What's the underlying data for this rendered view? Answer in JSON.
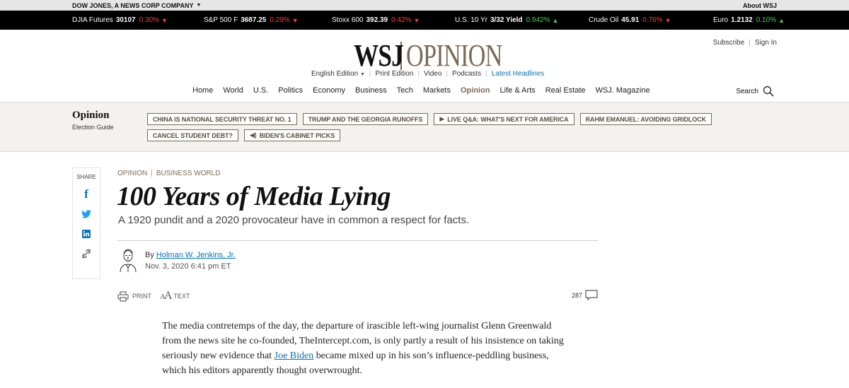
{
  "topstrip": {
    "brand": "DOW JONES, A NEWS CORP COMPANY",
    "about": "About WSJ"
  },
  "ticker": [
    {
      "name": "DJIA Futures",
      "value": "30107",
      "change": "0.30%",
      "dir": "down"
    },
    {
      "name": "S&P 500 F",
      "value": "3687.25",
      "change": "0.29%",
      "dir": "down"
    },
    {
      "name": "Stoxx 600",
      "value": "392.39",
      "change": "0.42%",
      "dir": "down"
    },
    {
      "name": "U.S. 10 Yr",
      "value": "3/32 Yield",
      "change": "0.942%",
      "dir": "up"
    },
    {
      "name": "Crude Oil",
      "value": "45.91",
      "change": "0.76%",
      "dir": "down"
    },
    {
      "name": "Euro",
      "value": "1.2132",
      "change": "0.10%",
      "dir": "up"
    }
  ],
  "header": {
    "logo_wsj": "WSJ",
    "logo_section": "OPINION",
    "subscribe": "Subscribe",
    "signin": "Sign In",
    "edition": "English Edition",
    "links": [
      "Print Edition",
      "Video",
      "Podcasts",
      "Latest Headlines"
    ],
    "search": "Search"
  },
  "nav": [
    "Home",
    "World",
    "U.S.",
    "Politics",
    "Economy",
    "Business",
    "Tech",
    "Markets",
    "Opinion",
    "Life & Arts",
    "Real Estate",
    "WSJ. Magazine"
  ],
  "section": {
    "title": "Opinion",
    "subtitle": "Election Guide",
    "pills": [
      "CHINA IS NATIONAL SECURITY THREAT NO. 1",
      "TRUMP AND THE GEORGIA RUNOFFS",
      "LIVE Q&A: WHAT'S NEXT FOR AMERICA",
      "RAHM EMANUEL: AVOIDING GRIDLOCK",
      "CANCEL STUDENT DEBT?",
      "BIDEN'S CABINET PICKS"
    ]
  },
  "share": {
    "label": "SHARE"
  },
  "article": {
    "crumb1": "OPINION",
    "crumb2": "BUSINESS WORLD",
    "headline": "100 Years of Media Lying",
    "dek": "A 1920 pundit and a 2020 provocateur have in common a respect for facts.",
    "by": "By",
    "author": "Holman W. Jenkins, Jr.",
    "date": "Nov. 3, 2020 6:41 pm ET",
    "print": "PRINT",
    "text": "TEXT",
    "comments": "287",
    "body_pre": "The media contretemps of the day, the departure of irascible left-wing journalist Glenn Greenwald from the news site he co-founded, TheIntercept.com, is only partly a result of his insistence on taking seriously new evidence that ",
    "body_link": "Joe Biden",
    "body_post": " became mixed up in his son’s influence-peddling business, which his editors apparently thought overwrought."
  }
}
